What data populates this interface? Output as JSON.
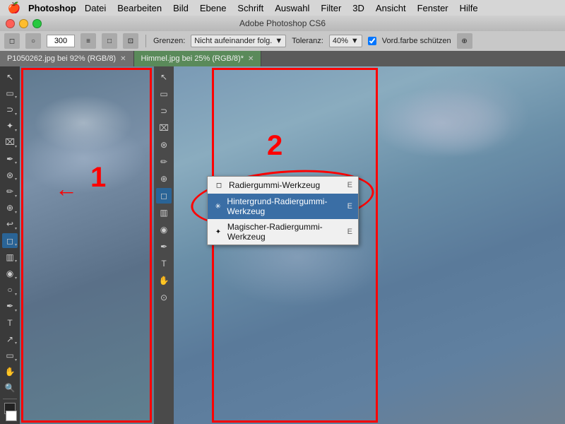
{
  "menubar": {
    "apple": "🍎",
    "appName": "Photoshop",
    "items": [
      "Datei",
      "Bearbeiten",
      "Bild",
      "Ebene",
      "Schrift",
      "Auswahl",
      "Filter",
      "3D",
      "Ansicht",
      "Fenster",
      "Hilfe"
    ]
  },
  "titlebar": {
    "title": "Adobe Photoshop CS6"
  },
  "optionsbar": {
    "size_value": "300",
    "grenzen_label": "Grenzen:",
    "grenzen_value": "Nicht aufeinander folg.",
    "toleranz_label": "Toleranz:",
    "toleranz_value": "40%",
    "vordfarbe_label": "Vord.farbe schützen"
  },
  "tabs": [
    {
      "label": "P1050262.jpg bei 92% (RGB/8)",
      "active": false,
      "closeable": true
    },
    {
      "label": "Himmel.jpg bei 25% (RGB/8)*",
      "active": true,
      "closeable": true
    }
  ],
  "annotations": {
    "num1": "1",
    "num2": "2"
  },
  "contextmenu": {
    "items": [
      {
        "label": "Radiergummi-Werkzeug",
        "shortcut": "E",
        "icon": "◻",
        "selected": false
      },
      {
        "label": "Hintergrund-Radiergummi-Werkzeug",
        "shortcut": "E",
        "icon": "✳",
        "selected": true
      },
      {
        "label": "Magischer-Radiergummi-Werkzeug",
        "shortcut": "E",
        "icon": "✦",
        "selected": false
      }
    ]
  },
  "tools": [
    "move",
    "rect-select",
    "lasso",
    "wand",
    "crop",
    "eyedropper",
    "spot-heal",
    "brush",
    "stamp",
    "history-brush",
    "eraser",
    "gradient",
    "blur",
    "dodge",
    "pen",
    "text",
    "path-select",
    "shape",
    "hand",
    "zoom"
  ]
}
